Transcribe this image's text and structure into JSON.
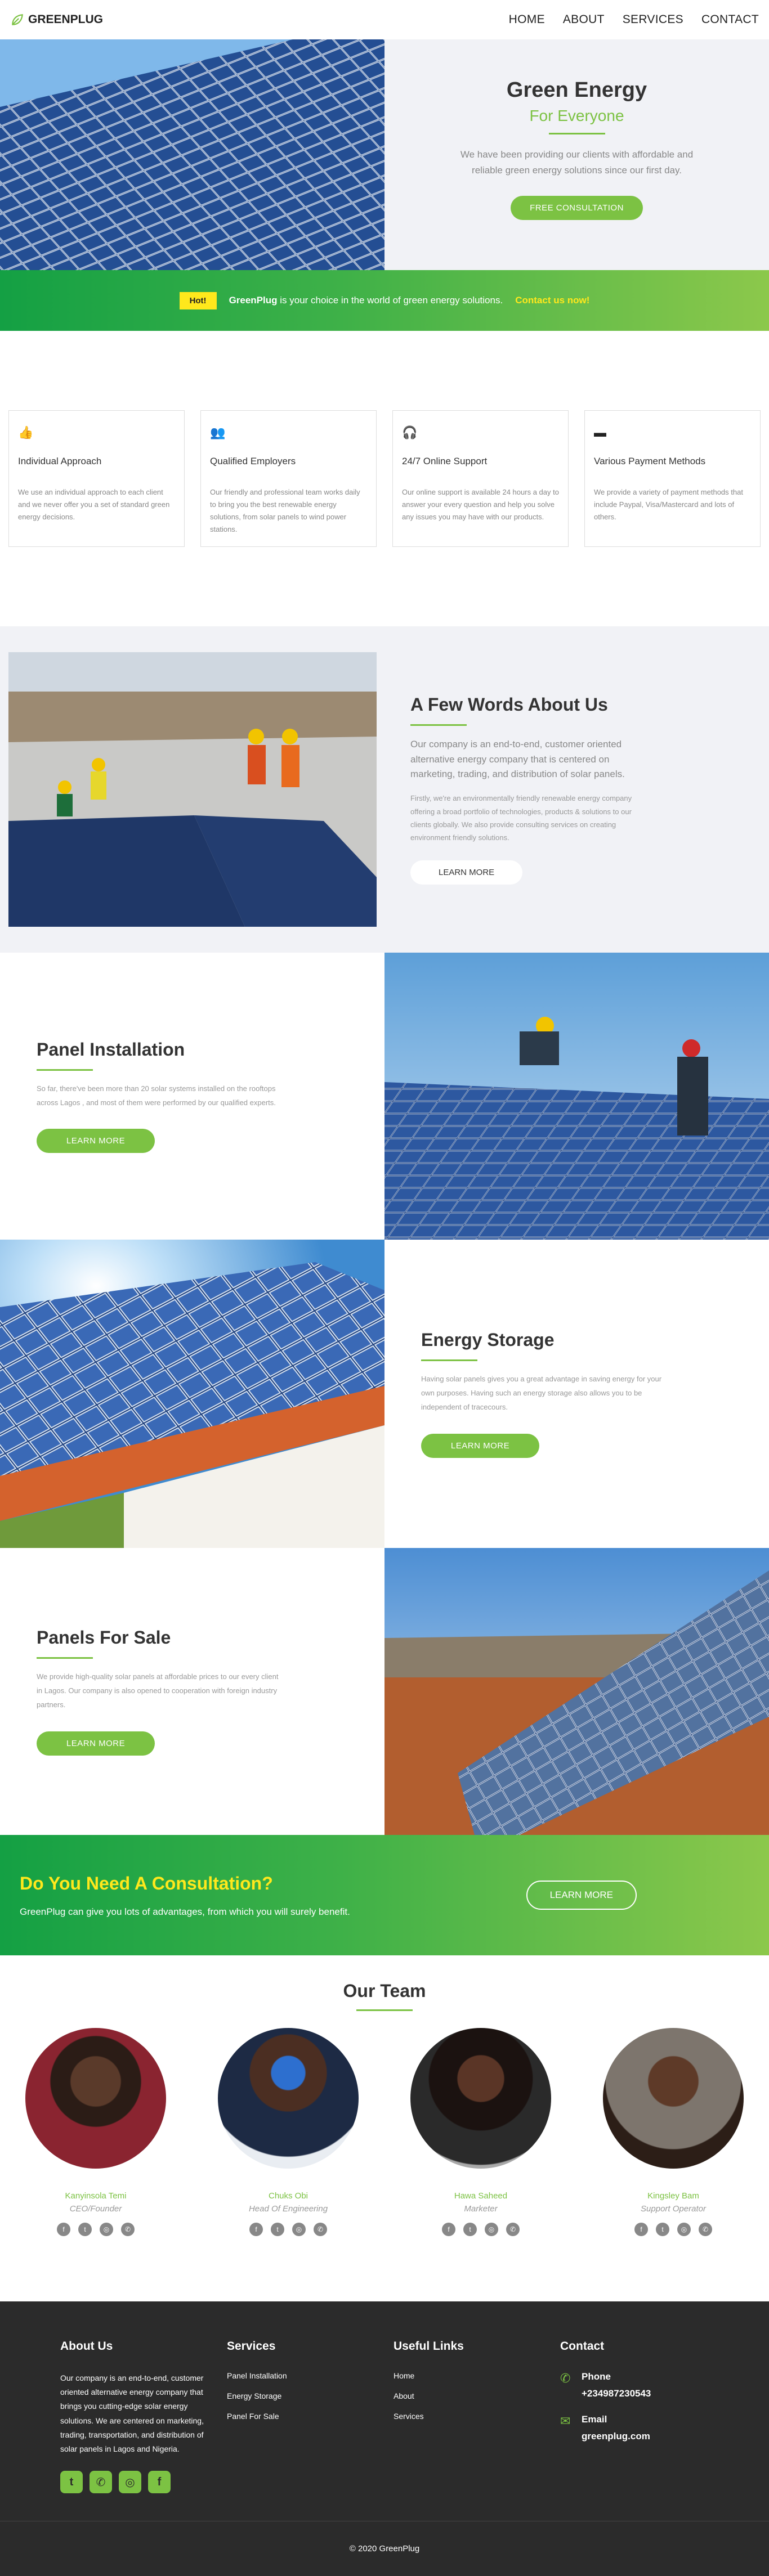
{
  "brand": {
    "name": "GREENPLUG",
    "accent": "#7cc243",
    "dark": "#2b2b2b"
  },
  "nav": {
    "items": [
      "HOME",
      "ABOUT",
      "SERVICES",
      "CONTACT"
    ]
  },
  "hero": {
    "title": "Green Energy",
    "subtitle": "For Everyone",
    "text": "We have been providing our clients with affordable and reliable green energy solutions since our first day.",
    "button": "FREE CONSULTATION"
  },
  "promo": {
    "badge": "Hot!",
    "brand": "GreenPlug",
    "text": " is your choice in the world of green energy solutions.",
    "link": "Contact us now!"
  },
  "features": [
    {
      "icon": "thumbs-up-icon",
      "title": "Individual Approach",
      "text": "We use an individual approach to each client and we never offer you a set of standard green energy decisions."
    },
    {
      "icon": "users-icon",
      "title": "Qualified Employers",
      "text": "Our friendly and professional team works daily to bring you the best renewable energy solutions, from solar panels to wind power stations."
    },
    {
      "icon": "headset-icon",
      "title": "24/7 Online Support",
      "text": "Our online support is available 24 hours a day to answer your every question and help you solve any issues you may have with our products."
    },
    {
      "icon": "credit-card-icon",
      "title": "Various Payment Methods",
      "text": "We provide a variety of payment methods that include Paypal, Visa/Mastercard and lots of others."
    }
  ],
  "about": {
    "title": "A Few Words About Us",
    "lead": "Our company is an end-to-end, customer oriented alternative energy company that is centered on marketing, trading, and distribution of solar panels.",
    "text": "Firstly, we're an environmentally friendly renewable energy company offering a broad portfolio of technologies, products & solutions to our clients globally. We also provide consulting services on creating environment friendly solutions.",
    "button": "LEARN MORE"
  },
  "services": [
    {
      "title": "Panel Installation",
      "text": "So far, there've been more than 20 solar systems installed on the rooftops across Lagos , and most of them were performed by our qualified experts.",
      "button": "LEARN MORE"
    },
    {
      "title": "Energy Storage",
      "text": "Having solar panels gives you a great advantage in saving energy for your own purposes. Having such an energy storage also allows you to be independent of tracecours.",
      "button": "LEARN MORE"
    },
    {
      "title": "Panels For Sale",
      "text": "We provide high-quality solar panels at affordable prices to our every client in Lagos. Our company is also opened to cooperation with foreign industry partners.",
      "button": "LEARN MORE"
    }
  ],
  "cta": {
    "title": "Do You Need A Consultation?",
    "text": "GreenPlug can give you lots of advantages, from which you will surely benefit.",
    "button": "LEARN MORE"
  },
  "team": {
    "title": "Our Team",
    "members": [
      {
        "name": "Kanyinsola Temi",
        "role": "CEO/Founder"
      },
      {
        "name": "Chuks Obi",
        "role": "Head Of Engineering"
      },
      {
        "name": "Hawa Saheed",
        "role": "Marketer"
      },
      {
        "name": "Kingsley Bam",
        "role": "Support Operator"
      }
    ]
  },
  "footer": {
    "about_title": "About Us",
    "about_text": "Our company is an end-to-end, customer oriented alternative energy company that brings you cutting-edge solar energy solutions. We are centered on marketing, trading, transportation, and distribution of solar panels in Lagos and Nigeria.",
    "services_title": "Services",
    "services": [
      "Panel Installation",
      "Energy Storage",
      "Panel For Sale"
    ],
    "links_title": "Useful Links",
    "links": [
      "Home",
      "About",
      "Services"
    ],
    "contact_title": "Contact",
    "phone_label": "Phone",
    "phone": "+234987230543",
    "email_label": "Email",
    "email": "greenplug.com",
    "copyright": "© 2020 GreenPlug"
  }
}
